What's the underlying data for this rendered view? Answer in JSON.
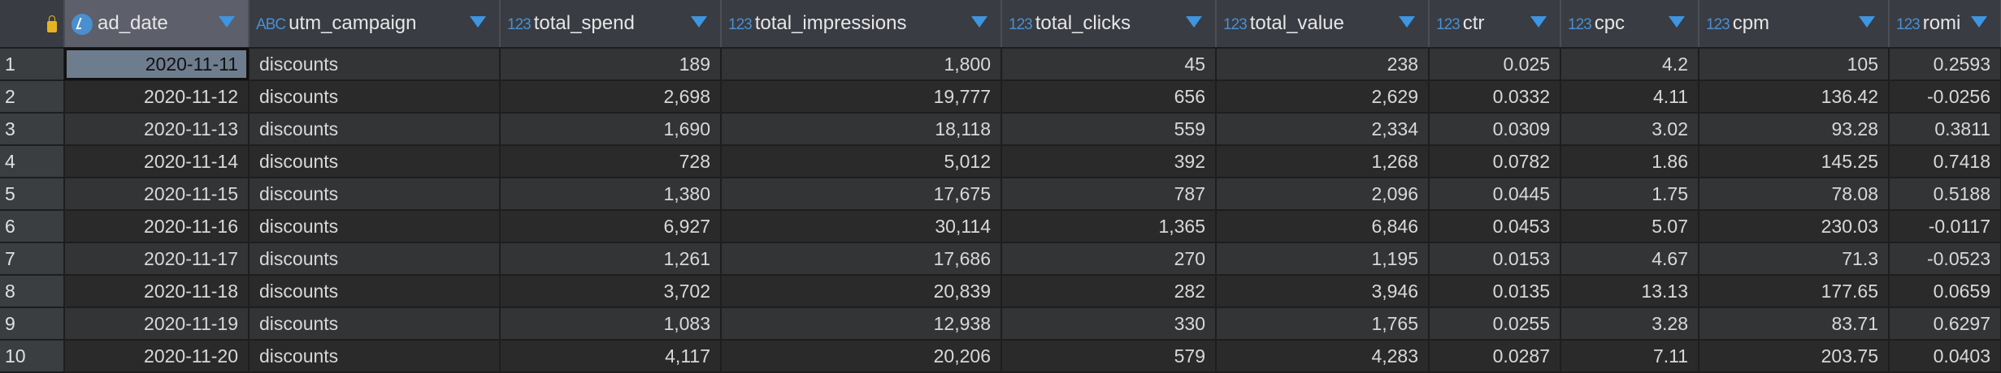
{
  "columns": [
    {
      "name": "ad_date",
      "type": "clock-icon"
    },
    {
      "name": "utm_campaign",
      "type": "ABC"
    },
    {
      "name": "total_spend",
      "type": "123"
    },
    {
      "name": "total_impressions",
      "type": "123"
    },
    {
      "name": "total_clicks",
      "type": "123"
    },
    {
      "name": "total_value",
      "type": "123"
    },
    {
      "name": "ctr",
      "type": "123"
    },
    {
      "name": "cpc",
      "type": "123"
    },
    {
      "name": "cpm",
      "type": "123"
    },
    {
      "name": "romi",
      "type": "123"
    }
  ],
  "rows": [
    [
      "1",
      "2020-11-11",
      "discounts",
      "189",
      "1,800",
      "45",
      "238",
      "0.025",
      "4.2",
      "105",
      "0.2593"
    ],
    [
      "2",
      "2020-11-12",
      "discounts",
      "2,698",
      "19,777",
      "656",
      "2,629",
      "0.0332",
      "4.11",
      "136.42",
      "-0.0256"
    ],
    [
      "3",
      "2020-11-13",
      "discounts",
      "1,690",
      "18,118",
      "559",
      "2,334",
      "0.0309",
      "3.02",
      "93.28",
      "0.3811"
    ],
    [
      "4",
      "2020-11-14",
      "discounts",
      "728",
      "5,012",
      "392",
      "1,268",
      "0.0782",
      "1.86",
      "145.25",
      "0.7418"
    ],
    [
      "5",
      "2020-11-15",
      "discounts",
      "1,380",
      "17,675",
      "787",
      "2,096",
      "0.0445",
      "1.75",
      "78.08",
      "0.5188"
    ],
    [
      "6",
      "2020-11-16",
      "discounts",
      "6,927",
      "30,114",
      "1,365",
      "6,846",
      "0.0453",
      "5.07",
      "230.03",
      "-0.0117"
    ],
    [
      "7",
      "2020-11-17",
      "discounts",
      "1,261",
      "17,686",
      "270",
      "1,195",
      "0.0153",
      "4.67",
      "71.3",
      "-0.0523"
    ],
    [
      "8",
      "2020-11-18",
      "discounts",
      "3,702",
      "20,839",
      "282",
      "3,946",
      "0.0135",
      "13.13",
      "177.65",
      "0.0659"
    ],
    [
      "9",
      "2020-11-19",
      "discounts",
      "1,083",
      "12,938",
      "330",
      "1,765",
      "0.0255",
      "3.28",
      "83.71",
      "0.6297"
    ],
    [
      "10",
      "2020-11-20",
      "discounts",
      "4,117",
      "20,206",
      "579",
      "4,283",
      "0.0287",
      "7.11",
      "203.75",
      "0.0403"
    ]
  ],
  "colors": {
    "accent": "#3f95e0",
    "selected_cell": "#6e7d8e",
    "lock": "#e6b422"
  }
}
